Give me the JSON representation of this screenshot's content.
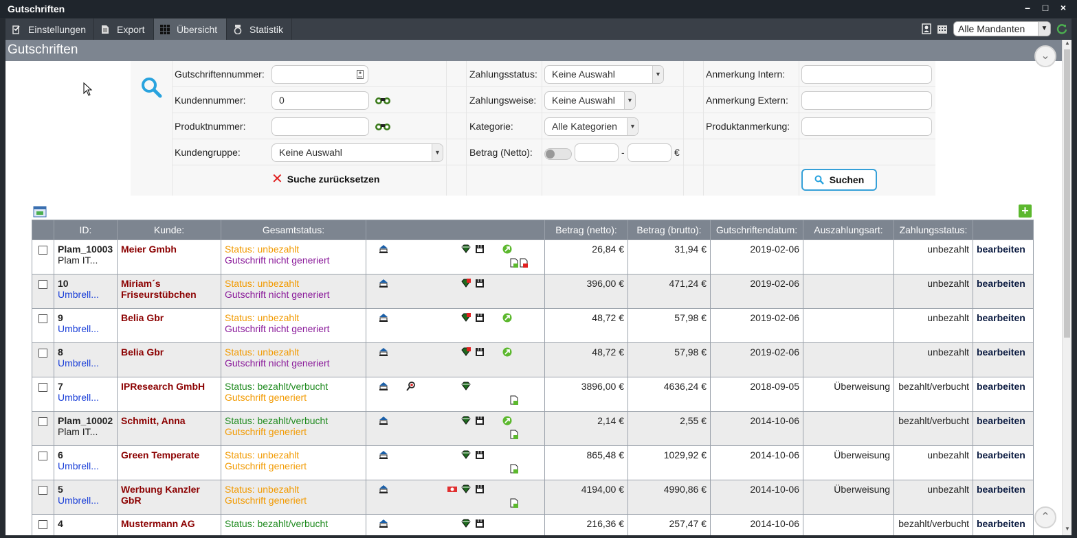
{
  "window": {
    "title": "Gutschriften",
    "controls": [
      "–",
      "□",
      "×"
    ]
  },
  "toolbar": {
    "items": [
      {
        "label": "Einstellungen",
        "icon": "settings-checklist-icon"
      },
      {
        "label": "Export",
        "icon": "document-icon"
      },
      {
        "label": "Übersicht",
        "icon": "grid-icon",
        "active": true
      },
      {
        "label": "Statistik",
        "icon": "medal-icon"
      }
    ],
    "mandant": "Alle Mandanten"
  },
  "section": {
    "title": "Gutschriften"
  },
  "search": {
    "labels": {
      "gutschriftennummer": "Gutschriftennummer:",
      "kundennummer": "Kundennummer:",
      "produktnummer": "Produktnummer:",
      "kundengruppe": "Kundengruppe:",
      "zahlungsstatus": "Zahlungsstatus:",
      "zahlungsweise": "Zahlungsweise:",
      "kategorie": "Kategorie:",
      "betrag": "Betrag (Netto):",
      "anmerkung_intern": "Anmerkung Intern:",
      "anmerkung_extern": "Anmerkung Extern:",
      "produktanmerkung": "Produktanmerkung:"
    },
    "values": {
      "gutschriftennummer": "",
      "kundennummer": "0",
      "produktnummer": "",
      "kundengruppe": "Keine Auswahl",
      "zahlungsstatus": "Keine Auswahl",
      "zahlungsweise": "Keine Auswahl",
      "kategorie": "Alle Kategorien",
      "betrag_von": "",
      "betrag_bis": "",
      "anmerkung_intern": "",
      "anmerkung_extern": "",
      "produktanmerkung": ""
    },
    "betrag_separator": "-",
    "currency": "€",
    "reset_label": "Suche zurücksetzen",
    "search_label": "Suchen"
  },
  "table": {
    "headers": [
      "",
      "ID:",
      "Kunde:",
      "Gesamtstatus:",
      "",
      "Betrag (netto):",
      "Betrag (brutto):",
      "Gutschriftendatum:",
      "Auszahlungsart:",
      "Zahlungsstatus:",
      ""
    ],
    "edit_label": "bearbeiten",
    "rows": [
      {
        "id": "Plam_10003",
        "sub": "Plam IT...",
        "sub_blue": false,
        "kunde": "Meier Gmbh",
        "status": "Status: unbezahlt",
        "status_class": "st-orange",
        "gen": "Gutschrift nicht generiert",
        "gen_class": "st-purple",
        "netto": "26,84 €",
        "brutto": "31,94 €",
        "datum": "2019-02-06",
        "art": "",
        "zstatus": "unbezahlt"
      },
      {
        "id": "10",
        "sub": "Umbrell...",
        "sub_blue": true,
        "kunde": "Miriam´s Friseurstübchen",
        "status": "Status: unbezahlt",
        "status_class": "st-orange",
        "gen": "Gutschrift nicht generiert",
        "gen_class": "st-purple",
        "netto": "396,00 €",
        "brutto": "471,24 €",
        "datum": "2019-02-06",
        "art": "",
        "zstatus": "unbezahlt"
      },
      {
        "id": "9",
        "sub": "Umbrell...",
        "sub_blue": true,
        "kunde": "Belia Gbr",
        "status": "Status: unbezahlt",
        "status_class": "st-orange",
        "gen": "Gutschrift nicht generiert",
        "gen_class": "st-purple",
        "netto": "48,72 €",
        "brutto": "57,98 €",
        "datum": "2019-02-06",
        "art": "",
        "zstatus": "unbezahlt"
      },
      {
        "id": "8",
        "sub": "Umbrell...",
        "sub_blue": true,
        "kunde": "Belia Gbr",
        "status": "Status: unbezahlt",
        "status_class": "st-orange",
        "gen": "Gutschrift nicht generiert",
        "gen_class": "st-purple",
        "netto": "48,72 €",
        "brutto": "57,98 €",
        "datum": "2019-02-06",
        "art": "",
        "zstatus": "unbezahlt"
      },
      {
        "id": "7",
        "sub": "Umbrell...",
        "sub_blue": true,
        "kunde": "IPResearch GmbH",
        "status": "Status: bezahlt/verbucht",
        "status_class": "st-green",
        "gen": "Gutschrift generiert",
        "gen_class": "st-orange",
        "netto": "3896,00 €",
        "brutto": "4636,24 €",
        "datum": "2018-09-05",
        "art": "Überweisung",
        "zstatus": "bezahlt/verbucht"
      },
      {
        "id": "Plam_10002",
        "sub": "Plam IT...",
        "sub_blue": false,
        "kunde": "Schmitt, Anna",
        "status": "Status: bezahlt/verbucht",
        "status_class": "st-green",
        "gen": "Gutschrift generiert",
        "gen_class": "st-orange",
        "netto": "2,14 €",
        "brutto": "2,55 €",
        "datum": "2014-10-06",
        "art": "",
        "zstatus": "bezahlt/verbucht"
      },
      {
        "id": "6",
        "sub": "Umbrell...",
        "sub_blue": true,
        "kunde": "Green Temperate",
        "status": "Status: unbezahlt",
        "status_class": "st-orange",
        "gen": "Gutschrift generiert",
        "gen_class": "st-orange",
        "netto": "865,48 €",
        "brutto": "1029,92 €",
        "datum": "2014-10-06",
        "art": "Überweisung",
        "zstatus": "unbezahlt"
      },
      {
        "id": "5",
        "sub": "Umbrell...",
        "sub_blue": true,
        "kunde": "Werbung Kanzler GbR",
        "status": "Status: unbezahlt",
        "status_class": "st-orange",
        "gen": "Gutschrift generiert",
        "gen_class": "st-orange",
        "netto": "4194,00 €",
        "brutto": "4990,86 €",
        "datum": "2014-10-06",
        "art": "Überweisung",
        "zstatus": "unbezahlt"
      },
      {
        "id": "4",
        "sub": "",
        "sub_blue": true,
        "kunde": "Mustermann AG",
        "status": "Status: bezahlt/verbucht",
        "status_class": "st-green",
        "gen": "",
        "gen_class": "st-orange",
        "netto": "216,36 €",
        "brutto": "257,47 €",
        "datum": "2014-10-06",
        "art": "",
        "zstatus": "bezahlt/verbucht"
      }
    ]
  },
  "colors": {
    "header_bg": "#7d8590",
    "accent_blue": "#35a0d8",
    "toolbar_bg": "#3a4048",
    "customer_red": "#8b0000",
    "add_green": "#5cb82e"
  }
}
